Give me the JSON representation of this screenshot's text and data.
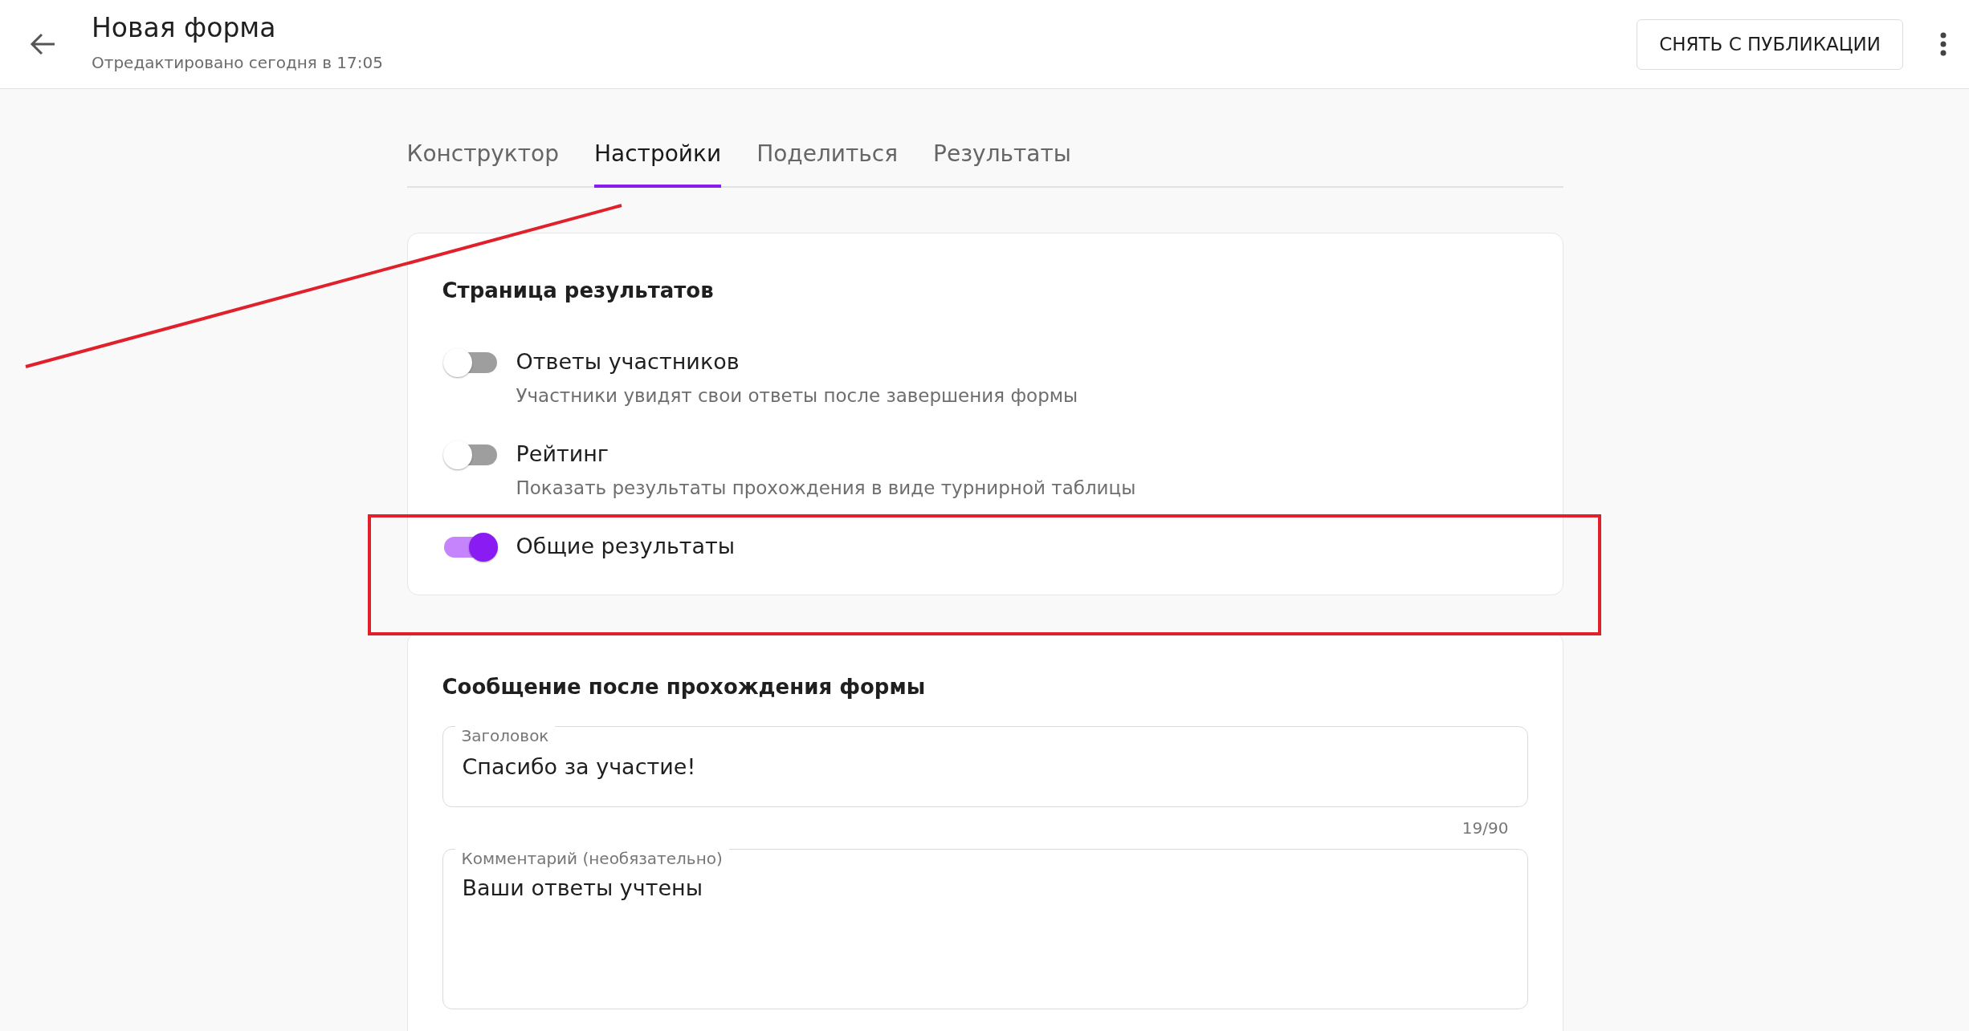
{
  "header": {
    "title": "Новая форма",
    "subtitle": "Отредактировано сегодня в 17:05",
    "action_button": "СНЯТЬ С ПУБЛИКАЦИИ"
  },
  "tabs": [
    {
      "label": "Конструктор",
      "selected": false
    },
    {
      "label": "Настройки",
      "selected": true
    },
    {
      "label": "Поделиться",
      "selected": false
    },
    {
      "label": "Результаты",
      "selected": false
    }
  ],
  "results_section": {
    "title": "Страница результатов",
    "options": [
      {
        "label": "Ответы участников",
        "description": "Участники увидят свои ответы после завершения формы",
        "on": false
      },
      {
        "label": "Рейтинг",
        "description": "Показать результаты прохождения в виде турнирной таблицы",
        "on": false
      },
      {
        "label": "Общие результаты",
        "on": true
      }
    ]
  },
  "message_section": {
    "title": "Сообщение после прохождения формы",
    "fields": [
      {
        "label": "Заголовок",
        "value": "Спасибо за участие!",
        "counter": "19/90",
        "kind": "input"
      },
      {
        "label": "Комментарий (необязательно)",
        "value": "Ваши ответы учтены",
        "kind": "textarea"
      }
    ]
  }
}
